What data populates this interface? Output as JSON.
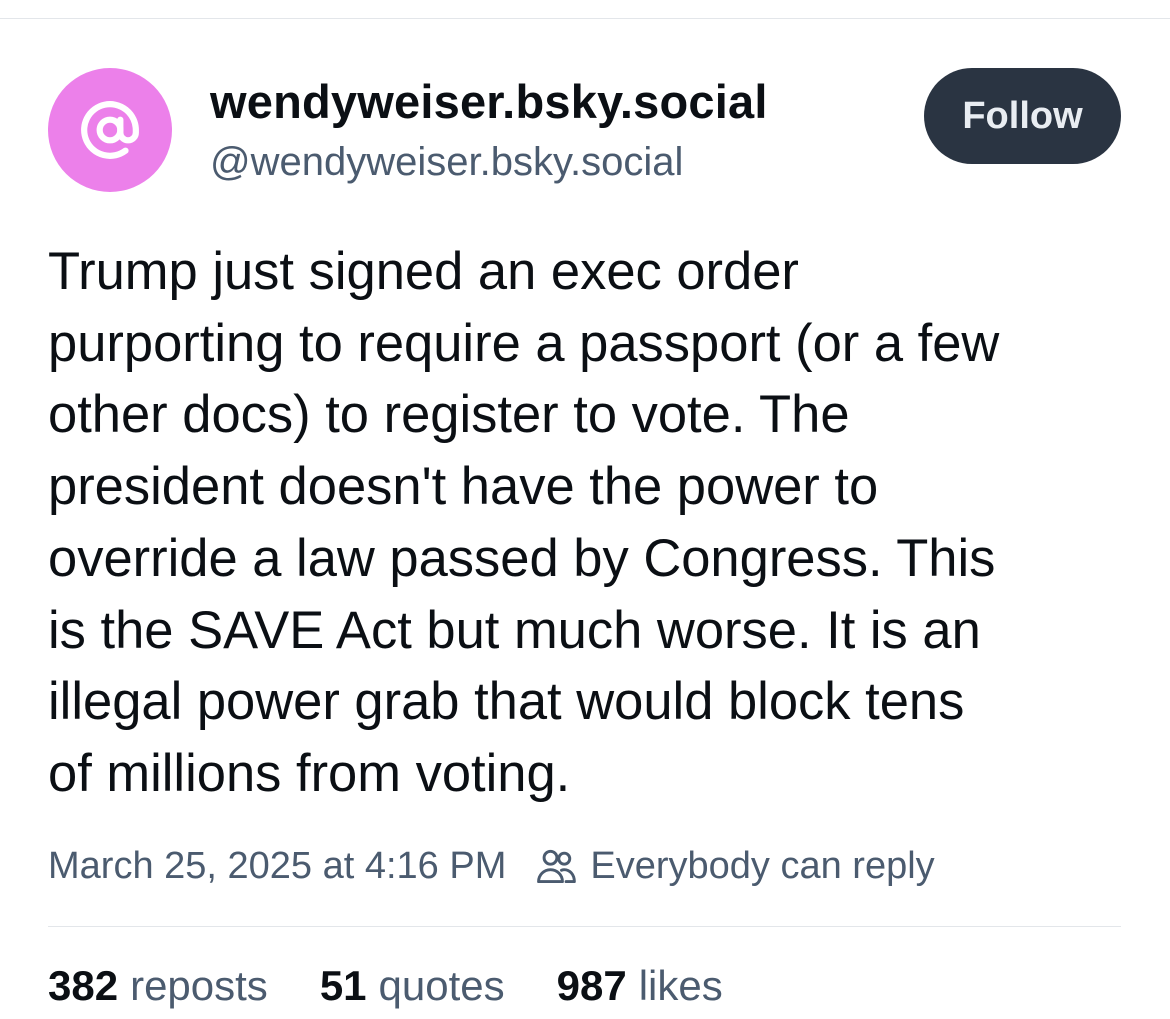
{
  "author": {
    "display_name": "wendyweiser.bsky.social",
    "handle": "@wendyweiser.bsky.social",
    "avatar_icon": "at-sign-icon",
    "avatar_color": "#ec80ea"
  },
  "follow_label": "Follow",
  "post": {
    "text": "Trump just signed an exec order\npurporting to require a passport (or a few\nother docs) to register to vote. The\npresident doesn't have the power to\noverride a law passed by Congress. This\nis the SAVE Act but much worse. It is an\nillegal power grab that would block tens\nof millions from voting."
  },
  "meta": {
    "timestamp": "March 25, 2025 at 4:16 PM",
    "reply_icon": "people-icon",
    "reply_setting": "Everybody can reply"
  },
  "stats": {
    "reposts_count": "382",
    "reposts_label": "reposts",
    "quotes_count": "51",
    "quotes_label": "quotes",
    "likes_count": "987",
    "likes_label": "likes"
  },
  "colors": {
    "follow_button_bg": "#2a3442",
    "secondary_text": "#4b5b6f",
    "primary_text": "#0b0f14"
  }
}
